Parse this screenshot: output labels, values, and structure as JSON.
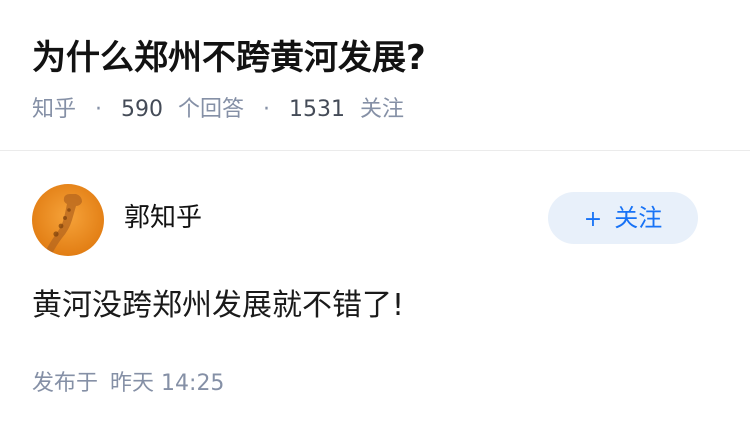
{
  "question": {
    "title": "为什么郑州不跨黄河发展?",
    "source": "知乎",
    "answer_count": "590",
    "answer_label": "个回答",
    "follow_count": "1531",
    "follow_label": "关注"
  },
  "answer": {
    "author_name": "郭知乎",
    "follow_button_label": "关注",
    "body": "黄河没跨郑州发展就不错了!",
    "published_label": "发布于",
    "published_day": "昨天",
    "published_time": "14:25"
  },
  "colors": {
    "meta_gray": "#8590a6",
    "accent_blue": "#1772f6",
    "button_bg": "#e8f0fa",
    "avatar_orange": "#f08a1c"
  },
  "icons": {
    "follow_plus": "plus-icon",
    "avatar_image": "giraffe-avatar"
  }
}
